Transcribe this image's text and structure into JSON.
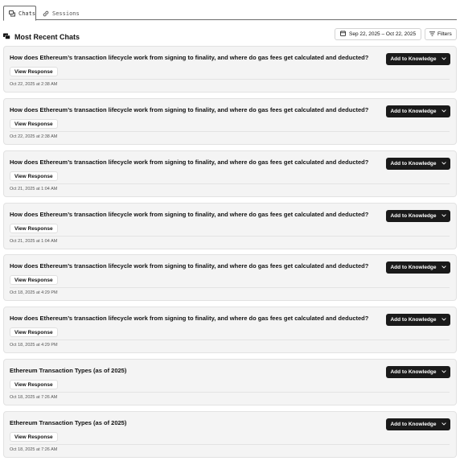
{
  "tabs": [
    {
      "label": "Chats",
      "icon": "chats-icon",
      "active": true
    },
    {
      "label": "Sessions",
      "icon": "link-icon",
      "active": false
    }
  ],
  "header": {
    "title": "Most Recent Chats",
    "date_range": "Sep 22, 2025 – Oct 22, 2025",
    "filters_label": "Filters"
  },
  "chats": [
    {
      "question": "How does Ethereum’s transaction lifecycle work from signing to finality, and where do gas fees get calculated and deducted?",
      "view_label": "View Response",
      "timestamp": "Oct 22, 2025 at 2:38 AM",
      "action_label": "Add to Knowledge"
    },
    {
      "question": "How does Ethereum’s transaction lifecycle work from signing to finality, and where do gas fees get calculated and deducted?",
      "view_label": "View Response",
      "timestamp": "Oct 22, 2025 at 2:38 AM",
      "action_label": "Add to Knowledge"
    },
    {
      "question": "How does Ethereum’s transaction lifecycle work from signing to finality, and where do gas fees get calculated and deducted?",
      "view_label": "View Response",
      "timestamp": "Oct 21, 2025 at 1:04 AM",
      "action_label": "Add to Knowledge"
    },
    {
      "question": "How does Ethereum’s transaction lifecycle work from signing to finality, and where do gas fees get calculated and deducted?",
      "view_label": "View Response",
      "timestamp": "Oct 21, 2025 at 1:04 AM",
      "action_label": "Add to Knowledge"
    },
    {
      "question": "How does Ethereum’s transaction lifecycle work from signing to finality, and where do gas fees get calculated and deducted?",
      "view_label": "View Response",
      "timestamp": "Oct 18, 2025 at 4:29 PM",
      "action_label": "Add to Knowledge"
    },
    {
      "question": "How does Ethereum’s transaction lifecycle work from signing to finality, and where do gas fees get calculated and deducted?",
      "view_label": "View Response",
      "timestamp": "Oct 18, 2025 at 4:29 PM",
      "action_label": "Add to Knowledge"
    },
    {
      "question": "Ethereum Transaction Types (as of 2025)",
      "view_label": "View Response",
      "timestamp": "Oct 18, 2025 at 7:26 AM",
      "action_label": "Add to Knowledge"
    },
    {
      "question": "Ethereum Transaction Types (as of 2025)",
      "view_label": "View Response",
      "timestamp": "Oct 18, 2025 at 7:26 AM",
      "action_label": "Add to Knowledge"
    }
  ],
  "colors": {
    "card_bg": "#f4f4f4",
    "primary_button": "#1a1a1a",
    "border": "#e2e2e2"
  }
}
